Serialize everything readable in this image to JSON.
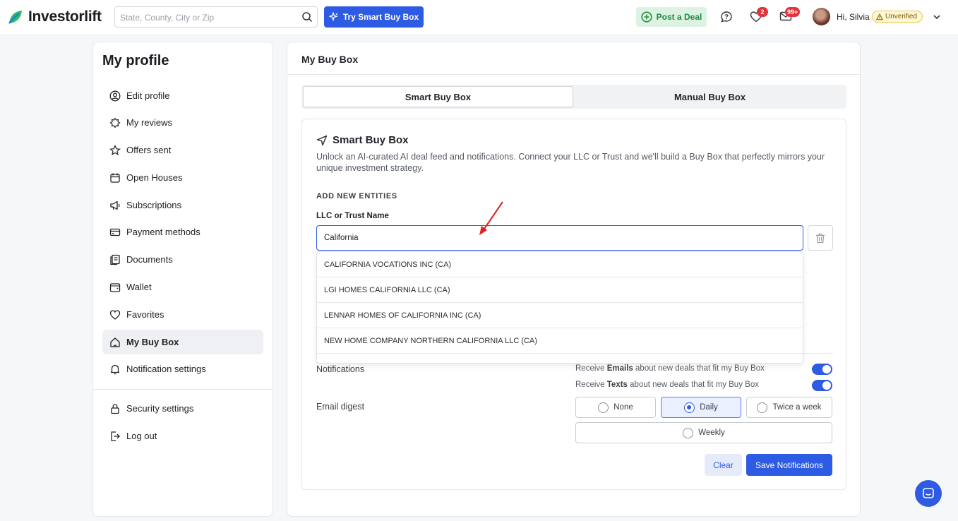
{
  "header": {
    "logo_text": "Investorlift",
    "search_placeholder": "State, County, City or Zip",
    "smart_buy_box_button": "Try Smart Buy Box",
    "post_deal_button": "Post a Deal",
    "favorites_count": "2",
    "messages_count": "99+",
    "greeting": "Hi, Silvia",
    "status_badge": "Unverified"
  },
  "sidebar": {
    "title": "My profile",
    "items": [
      {
        "label": "Edit profile",
        "icon": "user-circle-icon"
      },
      {
        "label": "My reviews",
        "icon": "star-badge-icon"
      },
      {
        "label": "Offers sent",
        "icon": "star-icon"
      },
      {
        "label": "Open Houses",
        "icon": "calendar-icon"
      },
      {
        "label": "Subscriptions",
        "icon": "megaphone-icon"
      },
      {
        "label": "Payment methods",
        "icon": "credit-card-icon"
      },
      {
        "label": "Documents",
        "icon": "documents-icon"
      },
      {
        "label": "Wallet",
        "icon": "wallet-icon"
      },
      {
        "label": "Favorites",
        "icon": "heart-icon"
      },
      {
        "label": "My Buy Box",
        "icon": "home-icon",
        "active": true
      },
      {
        "label": "Notification settings",
        "icon": "bell-icon"
      }
    ],
    "bottom_items": [
      {
        "label": "Security settings",
        "icon": "lock-icon"
      },
      {
        "label": "Log out",
        "icon": "logout-icon"
      }
    ]
  },
  "main": {
    "title": "My Buy Box",
    "tabs": [
      {
        "label": "Smart Buy Box",
        "active": true
      },
      {
        "label": "Manual Buy Box",
        "active": false
      }
    ],
    "card": {
      "title": "Smart Buy Box",
      "description": "Unlock an AI-curated AI deal feed and notifications. Connect your LLC or Trust and we'll build a Buy Box that perfectly mirrors your unique investment strategy.",
      "section_label": "ADD NEW ENTITIES",
      "field_label": "LLC or Trust Name",
      "field_value": "California",
      "suggestions": [
        "CALIFORNIA VOCATIONS INC (CA)",
        "LGI HOMES CALIFORNIA LLC (CA)",
        "LENNAR HOMES OF CALIFORNIA INC (CA)",
        "NEW HOME COMPANY NORTHERN CALIFORNIA LLC (CA)"
      ],
      "notifications_label": "Notifications",
      "email_notif": {
        "pre": "Receive ",
        "bold": "Emails",
        "post": " about new deals that fit my Buy Box",
        "enabled": true
      },
      "text_notif": {
        "pre": "Receive ",
        "bold": "Texts",
        "post": " about new deals that fit my Buy Box",
        "enabled": true
      },
      "digest_label": "Email digest",
      "digest_options": [
        "None",
        "Daily",
        "Twice a week",
        "Weekly"
      ],
      "digest_selected": "Daily",
      "clear_button": "Clear",
      "save_button": "Save Notifications"
    }
  },
  "colors": {
    "accent": "#2d5be3",
    "post_deal_bg": "#ddf3e2",
    "badge_red": "#e0343c",
    "unverified_bg": "#fff8d6"
  }
}
